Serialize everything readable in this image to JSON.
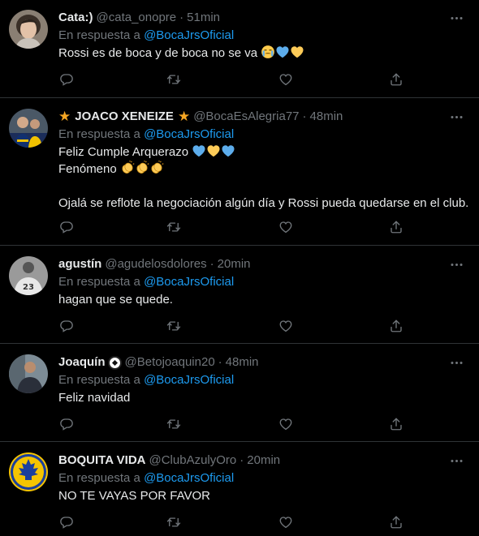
{
  "reply_prefix": "En respuesta a",
  "colors": {
    "background": "#000000",
    "text": "#e7e9ea",
    "secondary": "#71767b",
    "link": "#1d9bf0",
    "divider": "#2f3336"
  },
  "icons": {
    "more": "more-dots-icon",
    "reply": "reply-icon",
    "retweet": "retweet-icon",
    "like": "heart-icon",
    "share": "share-icon"
  },
  "tweets": [
    {
      "name": "Cata:)",
      "handle": "@cata_onopre",
      "time": "51min",
      "reply_to": "@BocaJrsOficial",
      "lines": [
        "Rossi es de boca y de boca no se va"
      ],
      "emoji": [
        "crying-face",
        "blue-heart",
        "yellow-heart"
      ]
    },
    {
      "name": "JOACO XENEIZE",
      "name_icons": [
        "star-icon",
        "star-icon"
      ],
      "handle": "@BocaEsAlegria77",
      "time": "48min",
      "reply_to": "@BocaJrsOficial",
      "lines": [
        "Feliz Cumple Arquerazo",
        "Fenómeno",
        "",
        "Ojalá se reflote la negociación algún día y Rossi pueda quedarse en el club."
      ],
      "emoji": [
        "blue-heart",
        "yellow-heart",
        "blue-heart",
        "clapping-hands",
        "clapping-hands",
        "clapping-hands"
      ]
    },
    {
      "name": "agustín",
      "handle": "@agudelosdolores",
      "time": "20min",
      "reply_to": "@BocaJrsOficial",
      "lines": [
        "hagan que se quede."
      ]
    },
    {
      "name": "Joaquín",
      "name_icons": [
        "soccer-ball-icon"
      ],
      "handle": "@Betojoaquin20",
      "time": "48min",
      "reply_to": "@BocaJrsOficial",
      "lines": [
        "Feliz navidad"
      ]
    },
    {
      "name": "BOQUITA VIDA",
      "handle": "@ClubAzulyOro",
      "time": "20min",
      "reply_to": "@BocaJrsOficial",
      "lines": [
        "NO TE VAYAS POR FAVOR"
      ]
    }
  ]
}
